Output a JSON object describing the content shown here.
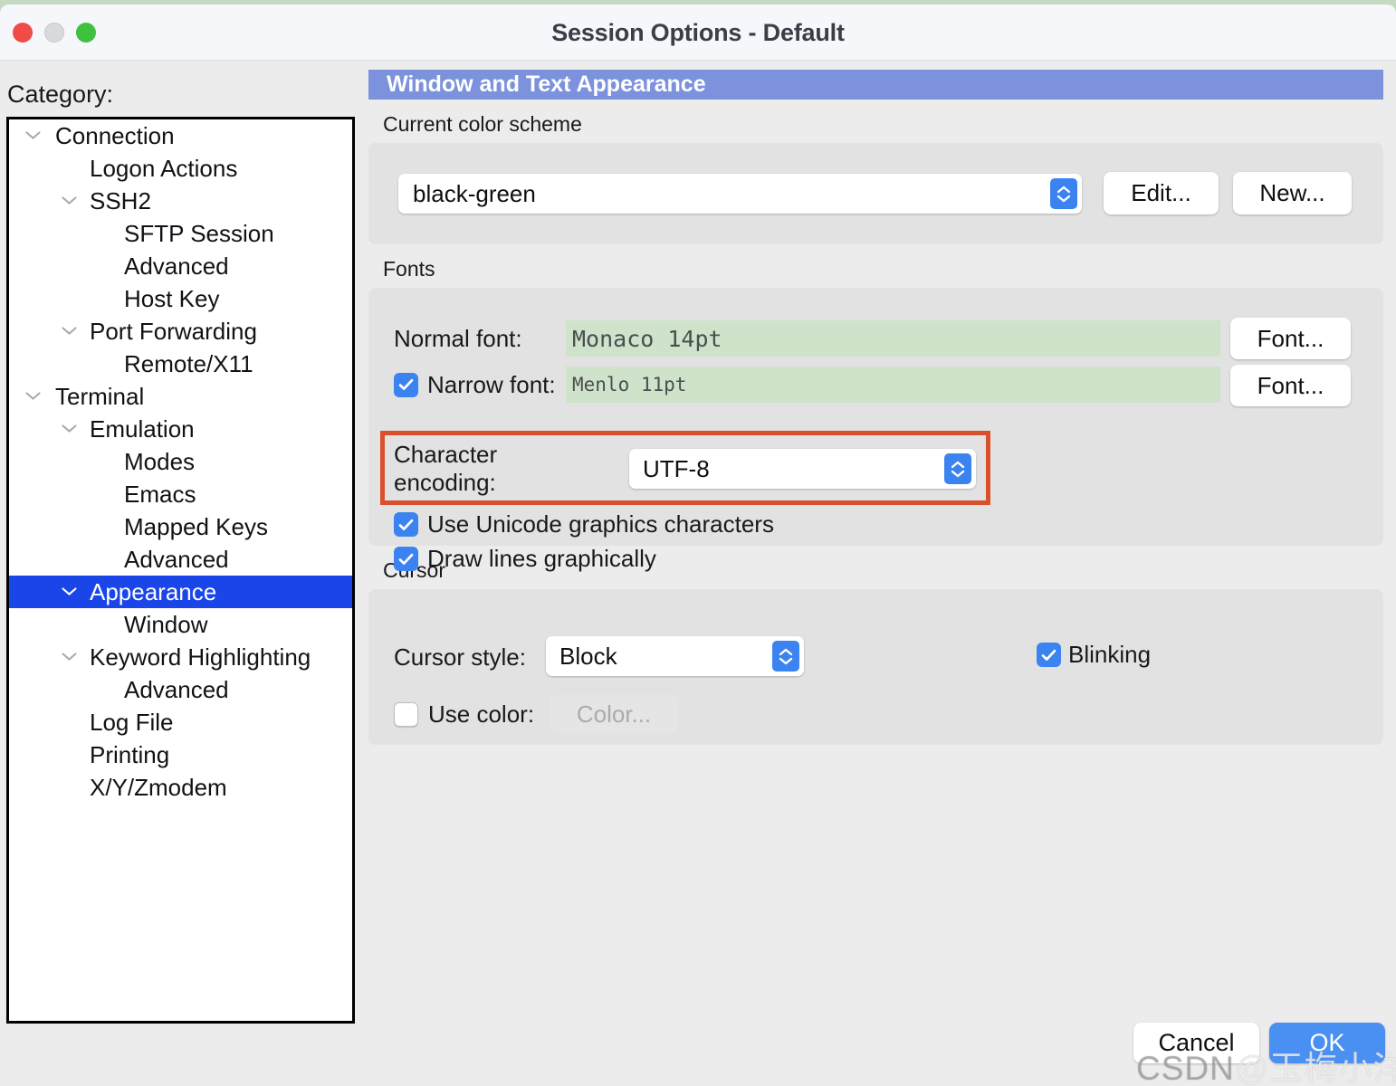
{
  "window": {
    "title": "Session Options - Default",
    "traffic_lights": [
      "close-red",
      "minimize-yellow",
      "maximize-green"
    ]
  },
  "sidebar": {
    "label": "Category:",
    "items": [
      {
        "label": "Connection",
        "level": 0,
        "twisty": "v",
        "selected": false
      },
      {
        "label": "Logon Actions",
        "level": 1,
        "twisty": "",
        "selected": false
      },
      {
        "label": "SSH2",
        "level": 1,
        "twisty": "v",
        "selected": false
      },
      {
        "label": "SFTP Session",
        "level": 2,
        "twisty": "",
        "selected": false
      },
      {
        "label": "Advanced",
        "level": 2,
        "twisty": "",
        "selected": false
      },
      {
        "label": "Host Key",
        "level": 2,
        "twisty": "",
        "selected": false
      },
      {
        "label": "Port Forwarding",
        "level": 1,
        "twisty": "v",
        "selected": false
      },
      {
        "label": "Remote/X11",
        "level": 2,
        "twisty": "",
        "selected": false
      },
      {
        "label": "Terminal",
        "level": 0,
        "twisty": "v",
        "selected": false
      },
      {
        "label": "Emulation",
        "level": 1,
        "twisty": "v",
        "selected": false
      },
      {
        "label": "Modes",
        "level": 2,
        "twisty": "",
        "selected": false
      },
      {
        "label": "Emacs",
        "level": 2,
        "twisty": "",
        "selected": false
      },
      {
        "label": "Mapped Keys",
        "level": 2,
        "twisty": "",
        "selected": false
      },
      {
        "label": "Advanced",
        "level": 2,
        "twisty": "",
        "selected": false
      },
      {
        "label": "Appearance",
        "level": 1,
        "twisty": "v",
        "selected": true
      },
      {
        "label": "Window",
        "level": 2,
        "twisty": "",
        "selected": false
      },
      {
        "label": "Keyword Highlighting",
        "level": 1,
        "twisty": "v",
        "selected": false
      },
      {
        "label": "Advanced",
        "level": 2,
        "twisty": "",
        "selected": false
      },
      {
        "label": "Log File",
        "level": 1,
        "twisty": "",
        "selected": false
      },
      {
        "label": "Printing",
        "level": 1,
        "twisty": "",
        "selected": false
      },
      {
        "label": "X/Y/Zmodem",
        "level": 1,
        "twisty": "",
        "selected": false
      }
    ]
  },
  "panel": {
    "header": "Window and Text Appearance",
    "color_scheme": {
      "group_title": "Current color scheme",
      "value": "black-green",
      "edit_label": "Edit...",
      "new_label": "New..."
    },
    "fonts": {
      "group_title": "Fonts",
      "normal_label": "Normal font:",
      "normal_value": "Monaco 14pt",
      "normal_button": "Font...",
      "narrow_label": "Narrow font:",
      "narrow_value": "Menlo 11pt",
      "narrow_button": "Font...",
      "narrow_checked": true,
      "encoding_label": "Character encoding:",
      "encoding_value": "UTF-8",
      "unicode_graphics_label": "Use Unicode graphics characters",
      "unicode_graphics_checked": true,
      "draw_lines_label": "Draw lines graphically",
      "draw_lines_checked": true
    },
    "cursor": {
      "group_title": "Cursor",
      "style_label": "Cursor style:",
      "style_value": "Block",
      "blinking_label": "Blinking",
      "blinking_checked": true,
      "use_color_label": "Use color:",
      "use_color_checked": false,
      "color_button": "Color..."
    }
  },
  "footer": {
    "cancel_label": "Cancel",
    "ok_label": "OK"
  },
  "watermark": {
    "prefix": "CSDN",
    "handle": "@玉梅小洋"
  },
  "colors": {
    "accent_blue": "#3b83f0",
    "selection_blue": "#1a45e8",
    "header_blue": "#7d92dd",
    "annotation_red": "#d9512c",
    "font_field_green": "#cfe3cb",
    "ok_button_blue": "#4a90f2"
  }
}
